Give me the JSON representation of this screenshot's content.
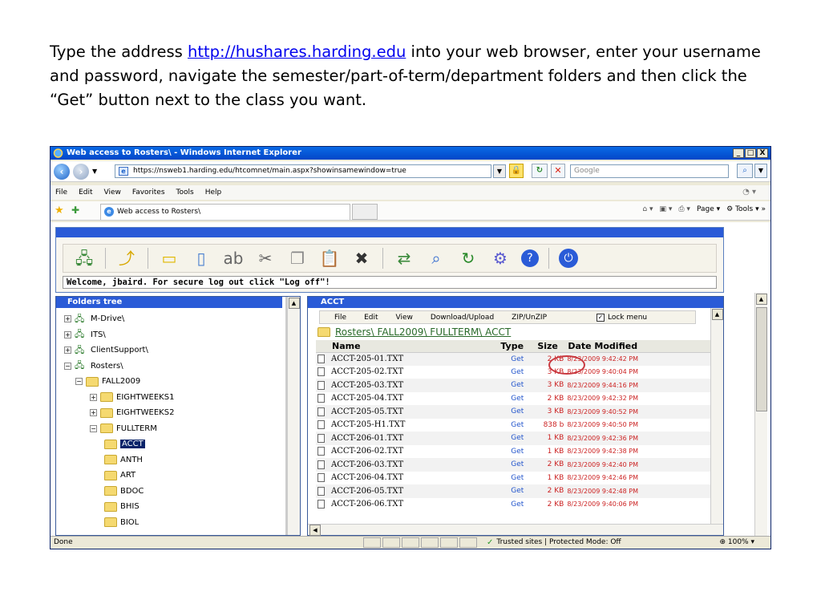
{
  "instructions": {
    "before": "Type the address ",
    "url": "http://hushares.harding.edu",
    "after": " into your web browser, enter your username and password, navigate the semester/part-of-term/department folders and then click the “Get” button next to the class you want."
  },
  "window": {
    "title": "Web access to Rosters\\  - Windows Internet Explorer",
    "minimize": "_",
    "maximize": "□",
    "close": "X"
  },
  "address": {
    "url": "https://nsweb1.harding.edu/htcomnet/main.aspx?showinsamewindow=true",
    "search_placeholder": "Google"
  },
  "menu": [
    "File",
    "Edit",
    "View",
    "Favorites",
    "Tools",
    "Help"
  ],
  "tab": {
    "title": "Web access to Rosters\\"
  },
  "commandbar": {
    "page": "Page",
    "tools": "Tools"
  },
  "app": {
    "welcome": "Welcome, jbaird. For secure log out click \"Log off\"!"
  },
  "folders": {
    "header": "Folders tree",
    "items": [
      {
        "label": "M-Drive\\",
        "exp": "+"
      },
      {
        "label": "ITS\\",
        "exp": "+"
      },
      {
        "label": "ClientSupport\\",
        "exp": "+"
      },
      {
        "label": "Rosters\\",
        "exp": "−"
      },
      {
        "label": "FALL2009",
        "exp": "−"
      },
      {
        "label": "EIGHTWEEKS1",
        "exp": "+"
      },
      {
        "label": "EIGHTWEEKS2",
        "exp": "+"
      },
      {
        "label": "FULLTERM",
        "exp": "−"
      },
      {
        "label": "ACCT",
        "exp": ""
      },
      {
        "label": "ANTH",
        "exp": ""
      },
      {
        "label": "ART",
        "exp": ""
      },
      {
        "label": "BDOC",
        "exp": ""
      },
      {
        "label": "BHIS",
        "exp": ""
      },
      {
        "label": "BIOL",
        "exp": ""
      }
    ]
  },
  "files": {
    "header": "ACCT",
    "menu": [
      "File",
      "Edit",
      "View",
      "Download/Upload",
      "ZIP/UnZIP"
    ],
    "lock_menu": "Lock menu",
    "breadcrumb": "Rosters\\ FALL2009\\ FULLTERM\\ ACCT",
    "columns": [
      "Name",
      "Type",
      "Size",
      "Date Modified"
    ],
    "rows": [
      {
        "name": "ACCT-205-01.TXT",
        "type": "Get",
        "size": "2 KB",
        "date": "8/23/2009 9:42:42 PM"
      },
      {
        "name": "ACCT-205-02.TXT",
        "type": "Get",
        "size": "3 KB",
        "date": "8/23/2009 9:40:04 PM"
      },
      {
        "name": "ACCT-205-03.TXT",
        "type": "Get",
        "size": "3 KB",
        "date": "8/23/2009 9:44:16 PM"
      },
      {
        "name": "ACCT-205-04.TXT",
        "type": "Get",
        "size": "2 KB",
        "date": "8/23/2009 9:42:32 PM"
      },
      {
        "name": "ACCT-205-05.TXT",
        "type": "Get",
        "size": "3 KB",
        "date": "8/23/2009 9:40:52 PM"
      },
      {
        "name": "ACCT-205-H1.TXT",
        "type": "Get",
        "size": "838 b",
        "date": "8/23/2009 9:40:50 PM"
      },
      {
        "name": "ACCT-206-01.TXT",
        "type": "Get",
        "size": "1 KB",
        "date": "8/23/2009 9:42:36 PM"
      },
      {
        "name": "ACCT-206-02.TXT",
        "type": "Get",
        "size": "1 KB",
        "date": "8/23/2009 9:42:38 PM"
      },
      {
        "name": "ACCT-206-03.TXT",
        "type": "Get",
        "size": "2 KB",
        "date": "8/23/2009 9:42:40 PM"
      },
      {
        "name": "ACCT-206-04.TXT",
        "type": "Get",
        "size": "1 KB",
        "date": "8/23/2009 9:42:46 PM"
      },
      {
        "name": "ACCT-206-05.TXT",
        "type": "Get",
        "size": "2 KB",
        "date": "8/23/2009 9:42:48 PM"
      },
      {
        "name": "ACCT-206-06.TXT",
        "type": "Get",
        "size": "2 KB",
        "date": "8/23/2009 9:40:06 PM"
      }
    ]
  },
  "status": {
    "text": "Done",
    "zone": "Trusted sites | Protected Mode: Off",
    "zoom": "100%"
  }
}
